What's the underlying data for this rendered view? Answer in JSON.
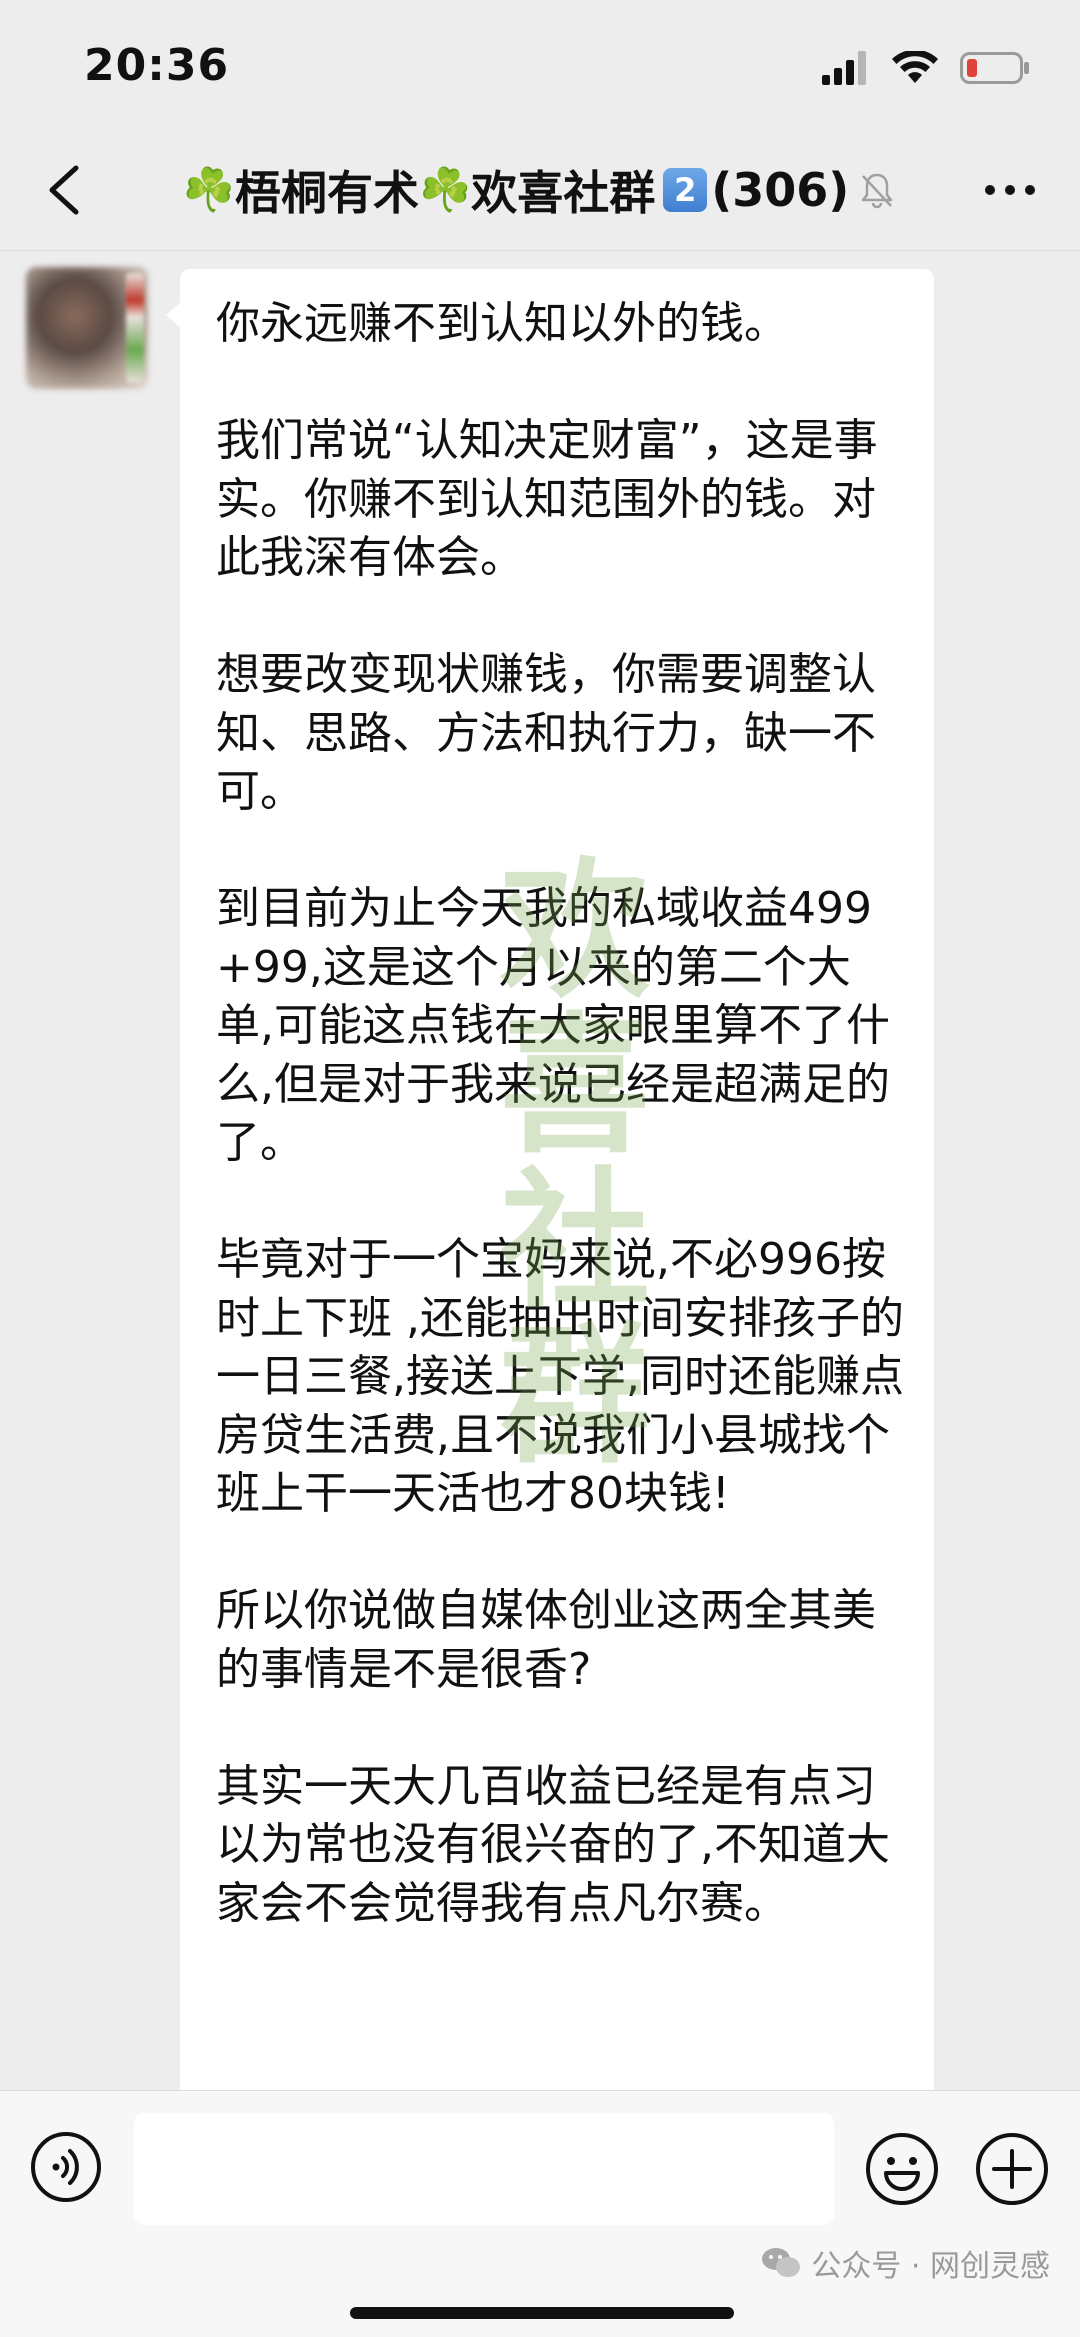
{
  "status_bar": {
    "time": "20:36",
    "icons": [
      "signal-icon",
      "wifi-icon",
      "battery-low-icon"
    ]
  },
  "nav": {
    "back_icon": "chevron-left-icon",
    "title_emoji": "☘️",
    "title_part1": "梧桐有术",
    "title_part2": "欢喜社群",
    "title_badge": "2",
    "member_count": "(306)",
    "mute_icon": "bell-muted-icon",
    "more_icon": "more-dots-icon"
  },
  "message": {
    "sender_avatar": "blurred-avatar",
    "paragraphs": [
      "你永远赚不到认知以外的钱。",
      "我们常说“认知决定财富”，这是事实。你赚不到认知范围外的钱。对此我深有体会。",
      "想要改变现状赚钱，你需要调整认知、思路、方法和执行力，缺一不可。",
      "到目前为止今天我的私域收益499+99,这是这个月以来的第二个大单,可能这点钱在大家眼里算不了什么,但是对于我来说已经是超满足的了。",
      "毕竟对于一个宝妈来说,不必996按时上下班 ,还能抽出时间安排孩子的一日三餐,接送上下学,同时还能赚点房贷生活费,且不说我们小县城找个班上干一天活也才80块钱!",
      "所以你说做自媒体创业这两全其美的事情是不是很香?",
      "其实一天大几百收益已经是有点习以为常也没有很兴奋的了,不知道大家会不会觉得我有点凡尔赛。"
    ],
    "watermark_chars": [
      "欢",
      "喜",
      "社",
      "群"
    ]
  },
  "input_bar": {
    "voice_icon": "voice-icon",
    "input_value": "",
    "emoji_icon": "emoji-icon",
    "plus_icon": "plus-icon"
  },
  "credit": {
    "icon": "wechat-official-account-icon",
    "text": "公众号 · 网创灵感"
  },
  "colors": {
    "background": "#ededed",
    "bubble": "#ffffff",
    "clover": "#2a9d3a",
    "battery_low": "#e0413a"
  }
}
